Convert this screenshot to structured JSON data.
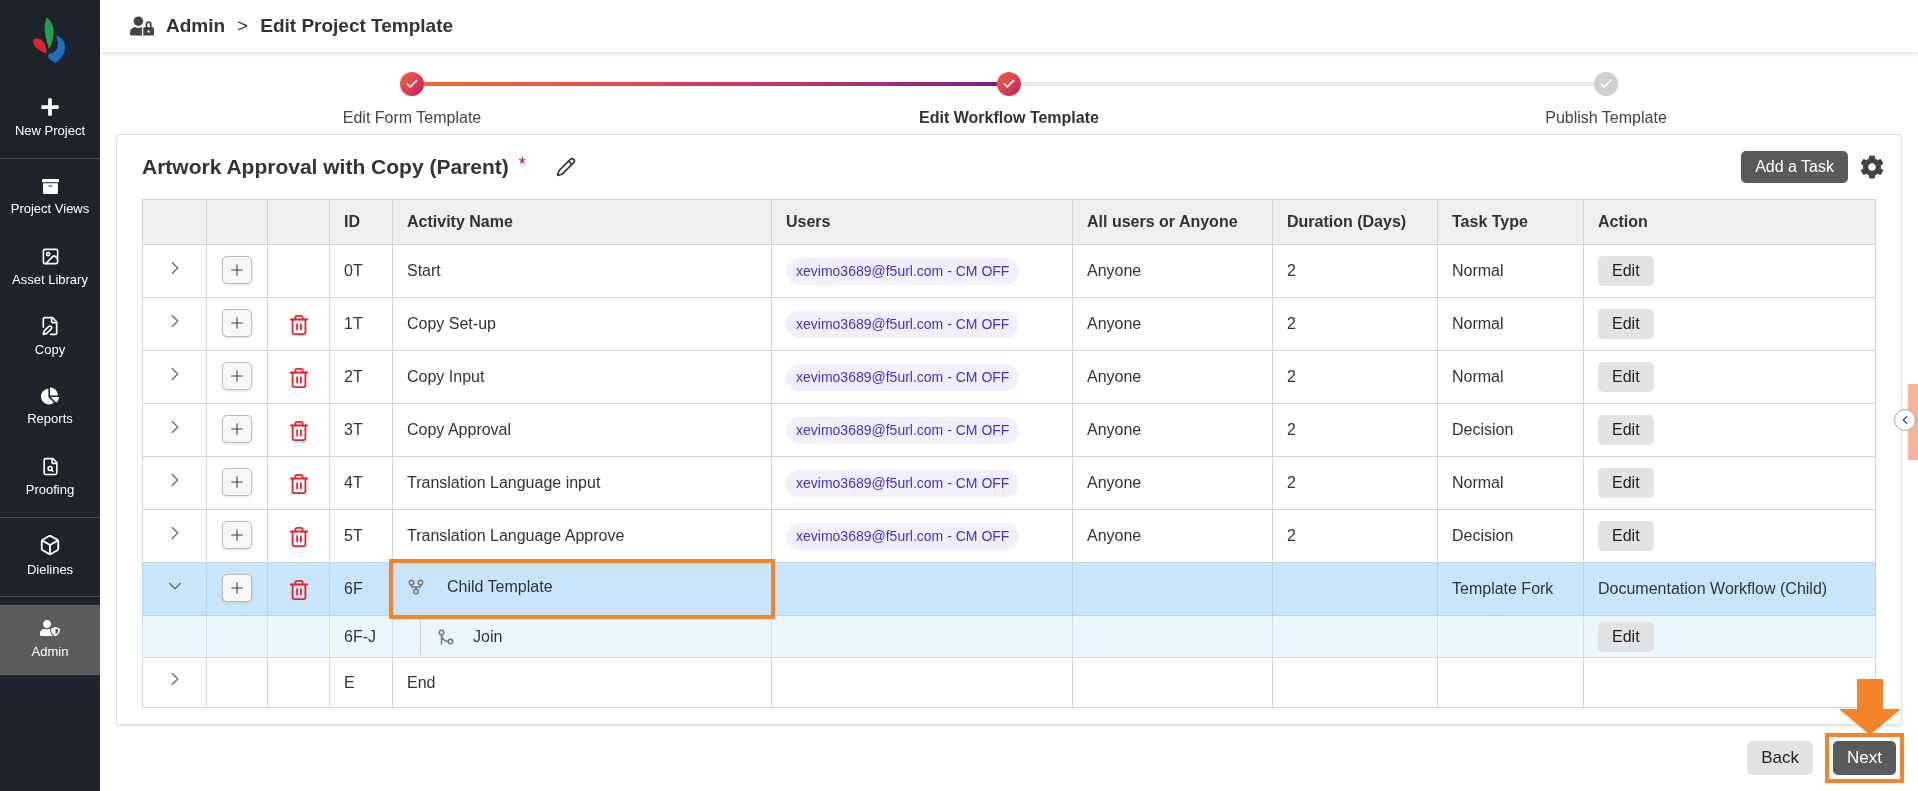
{
  "sidebar": {
    "groups": [
      [
        {
          "label": "New Project",
          "selected": false
        }
      ],
      [
        {
          "label": "Project Views",
          "selected": false
        },
        {
          "label": "Asset Library",
          "selected": false
        },
        {
          "label": "Copy",
          "selected": false
        },
        {
          "label": "Reports",
          "selected": false
        },
        {
          "label": "Proofing",
          "selected": false
        }
      ],
      [
        {
          "label": "Dielines",
          "selected": false
        }
      ],
      [
        {
          "label": "Admin",
          "selected": true
        }
      ]
    ]
  },
  "breadcrumb": [
    "Admin",
    ">",
    "Edit Project Template"
  ],
  "steps": [
    {
      "label": "Edit Form Template",
      "done": true,
      "selected": false
    },
    {
      "label": "Edit Workflow Template",
      "done": true,
      "selected": true
    },
    {
      "label": "Publish Template",
      "done": false,
      "selected": false
    }
  ],
  "template": {
    "title": "Artwork Approval with Copy (Parent)",
    "required_mark": "*",
    "add_task": "Add a Task"
  },
  "table": {
    "columns": [
      "",
      "",
      "",
      "ID",
      "Activity Name",
      "Users",
      "All users or Anyone",
      "Duration (Days)",
      "Task Type",
      "Action"
    ],
    "rows": [
      {
        "kind": "task",
        "expanded": false,
        "selected": false,
        "callout": false,
        "can_add": true,
        "can_delete": false,
        "id": "0T",
        "activity": "Start",
        "user": "xevimo3689@f5url.com - CM OFF",
        "assign": "Anyone",
        "duration": "2",
        "task_type": "Normal",
        "action": "Edit"
      },
      {
        "kind": "task",
        "expanded": false,
        "selected": false,
        "callout": false,
        "can_add": true,
        "can_delete": true,
        "id": "1T",
        "activity": "Copy Set-up",
        "user": "xevimo3689@f5url.com - CM OFF",
        "assign": "Anyone",
        "duration": "2",
        "task_type": "Normal",
        "action": "Edit"
      },
      {
        "kind": "task",
        "expanded": false,
        "selected": false,
        "callout": false,
        "can_add": true,
        "can_delete": true,
        "id": "2T",
        "activity": "Copy Input",
        "user": "xevimo3689@f5url.com - CM OFF",
        "assign": "Anyone",
        "duration": "2",
        "task_type": "Normal",
        "action": "Edit"
      },
      {
        "kind": "task",
        "expanded": false,
        "selected": false,
        "callout": false,
        "can_add": true,
        "can_delete": true,
        "id": "3T",
        "activity": "Copy Approval",
        "user": "xevimo3689@f5url.com - CM OFF",
        "assign": "Anyone",
        "duration": "2",
        "task_type": "Decision",
        "action": "Edit"
      },
      {
        "kind": "task",
        "expanded": false,
        "selected": false,
        "callout": false,
        "can_add": true,
        "can_delete": true,
        "id": "4T",
        "activity": "Translation Language input",
        "user": "xevimo3689@f5url.com - CM OFF",
        "assign": "Anyone",
        "duration": "2",
        "task_type": "Normal",
        "action": "Edit"
      },
      {
        "kind": "task",
        "expanded": false,
        "selected": false,
        "callout": false,
        "can_add": true,
        "can_delete": true,
        "id": "5T",
        "activity": "Translation Language Approve",
        "user": "xevimo3689@f5url.com - CM OFF",
        "assign": "Anyone",
        "duration": "2",
        "task_type": "Decision",
        "action": "Edit"
      },
      {
        "kind": "fork",
        "expanded": true,
        "selected": true,
        "callout": true,
        "can_add": true,
        "can_delete": true,
        "id": "6F",
        "activity": "Child Template",
        "task_type": "Template Fork",
        "action": "Documentation Workflow (Child)",
        "children": [
          {
            "kind": "join",
            "id": "6F-J",
            "activity": "Join",
            "action": "Edit"
          }
        ]
      },
      {
        "kind": "end",
        "expanded": false,
        "selected": false,
        "callout": false,
        "can_add": false,
        "can_delete": false,
        "id": "E",
        "activity": "End"
      }
    ]
  },
  "footer_buttons": [
    {
      "label": "Back",
      "kind": "secondary",
      "callout": false
    },
    {
      "label": "Next",
      "kind": "primary",
      "callout": true
    }
  ]
}
